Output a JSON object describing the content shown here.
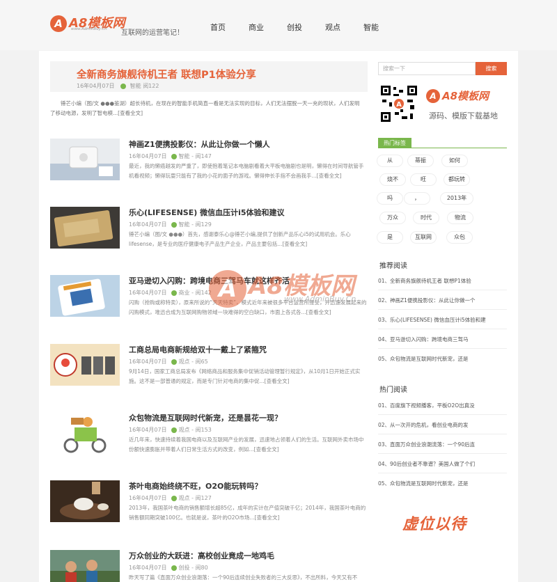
{
  "header": {
    "logo_text": "A8模板网",
    "logo_sub": "www.AdminBuy.Cn",
    "slogan": "互联网的运营笔记！",
    "nav": [
      "首页",
      "商业",
      "创投",
      "观点",
      "智能"
    ]
  },
  "feature": {
    "title": "全新商务旗舰待机王者 联想P1体验分享",
    "date": "16年04月07日",
    "category": "智能",
    "views": "阅122",
    "excerpt": "锤芒小编（图/文 ●●●鉴湖）超长待机，在现在的智能手机简直一看是无法实现的目标，人们无法摆脱一天一充的现状，人们发明了移动电源，发明了智电模...[查看全文]"
  },
  "posts": [
    {
      "title": "神画Z1便携投影仪：从此让你做一个懒人",
      "date": "16年04月07日",
      "category": "智能",
      "views": "阅147",
      "excerpt": "最近，我的懒癌越发的严重了，即使抱着笔记本电脑剧看着大平板电脑剧也是明，懒得在时间导航管手机看视频；懒得玩耍只能有了我的小花的面子的游戏。懒得伸长手指不会画我手...[查看全文]"
    },
    {
      "title": "乐心(LIFESENSE) 微信血压计i5体验和建议",
      "date": "16年04月07日",
      "category": "智能",
      "views": "阅129",
      "excerpt": "锤芒小编（图/文 ●●●）首先，感谢泰乐心@锤芒小编,提供了创新产品乐心i5的试用机会。乐心lifesense，是专业的医疗健康电子产品生产企业，产品主要包括...[查看全文]"
    },
    {
      "title": "亚马逊切入闪购：跨境电商三驾马车就这样齐活",
      "date": "16年04月07日",
      "category": "商业",
      "views": "阅142",
      "excerpt": "闪购（抢购或称特卖），原来所说的“天天特卖”，模式近年来被很多平台运营所接受，并迅速发展起来的闪购模式，堆迅合成为互联网购物领域一块难得的空白缺口，市面上各式各...[查看全文]"
    },
    {
      "title": "工商总局电商新规给双十一戴上了紧箍咒",
      "date": "16年04月07日",
      "category": "观点",
      "views": "阅65",
      "excerpt": "9月14日，国家工商总局发布《网络商品和服务集中促销活动管理暂行规定》，从10月1日开始正式实施。这不是一部普通的规定，而是专门针对电商的集中促...[查看全文]"
    },
    {
      "title": "众包物流是互联网时代新宠，还是昙花一现？",
      "date": "16年04月07日",
      "category": "观点",
      "views": "阅153",
      "excerpt": "近几年来，快速持续着我国电商以及互联网产业的发展，迅速地占领着人们的生活。互联网外卖市场中份额快速膨胀并带着人们日常生活方式的改变，例如...[查看全文]"
    },
    {
      "title": "茶叶电商始终绕不旺，O2O能玩转吗？",
      "date": "16年04月07日",
      "category": "观点",
      "views": "阅127",
      "excerpt": "2013年，我国茶叶电商的销售额增长超85亿，成年的实计在产值突破千亿；2014年，我国茶叶电商的销售额同期突破100亿。也就是说，茶叶的O2O市场...[查看全文]"
    },
    {
      "title": "万众创业的大跃进：高校创业竟成一地鸡毛",
      "date": "16年04月07日",
      "category": "创投",
      "views": "阅80",
      "excerpt": "昨天写了篇《直面万众创业浪潮落：一个90后连续创业失败者的三大反思》，不出所料，今天又有不"
    }
  ],
  "sidebar": {
    "search_placeholder": "搜索一下",
    "search_button": "搜索",
    "brand_text": "A8模板网",
    "brand_slogan": "源码、模版下载基地",
    "tags_title": "热门标签",
    "tags": [
      "从",
      "蒂振",
      "如何",
      "烧不",
      "旺",
      "都玩转",
      "吗",
      "，",
      "2013年",
      "万众",
      "时代",
      "物流",
      "是",
      "互联网",
      "众包"
    ],
    "recommend_title": "推荐阅读",
    "recommend": [
      "01、全新商务旗舰待机王者 联想P1体验",
      "02、神画Z1便携投影仪：从此让你做一个",
      "03、乐心(LIFESENSE) 微信血压计i5体验和建",
      "04、亚马逊切入闪购：跨境电商三驾马",
      "05、众包物流是互联网时代新宠，还是"
    ],
    "hot_title": "热门阅读",
    "hot": [
      "01、百度旗下视频播客，平板O2O出真没",
      "02、从一次开的危机，看创业电商的发",
      "03、直面万众创业浪潮流落：一个90后连",
      "04、90后创业者不靠谱？美国人做了个们",
      "05、众包物流是互联网时代新宠，还是"
    ],
    "footer_image_text": "虚位以待"
  },
  "watermark": {
    "text": "A8模板网",
    "url": "www.AdminBuy.Cn"
  },
  "colors": {
    "accent": "#e5633a",
    "tag_green": "#7ab74c"
  }
}
